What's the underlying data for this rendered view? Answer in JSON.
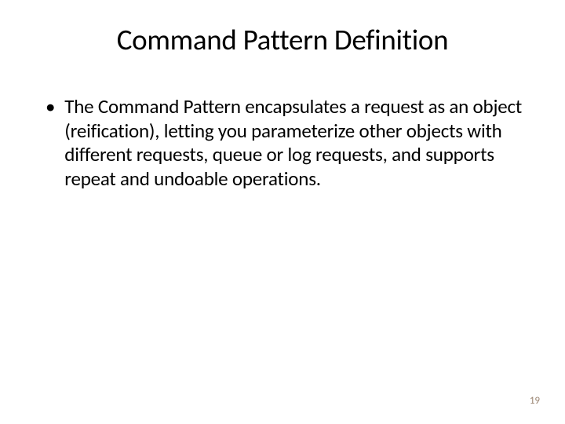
{
  "slide": {
    "title": "Command Pattern Definition",
    "bullet_marker": "•",
    "bullet_text": "The Command Pattern encapsulates a request as an object (reification), letting you parameterize other objects with different requests, queue or log requests, and supports repeat and undoable operations.",
    "page_number": "19"
  }
}
